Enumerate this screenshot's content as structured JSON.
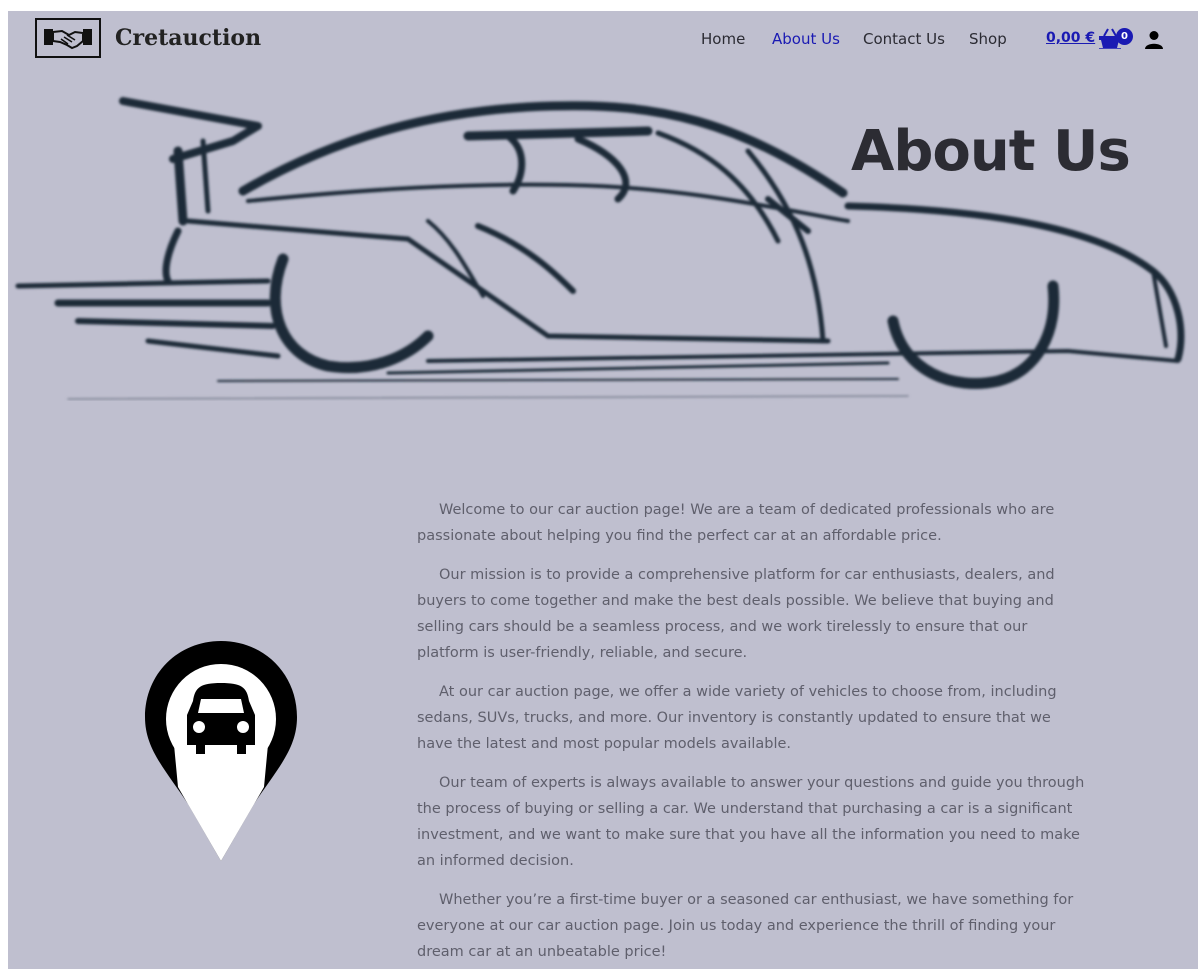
{
  "site": {
    "title": "Cretauction",
    "logo_icon": "handshake-icon"
  },
  "nav": {
    "items": [
      {
        "label": "Home",
        "active": false
      },
      {
        "label": "About Us",
        "active": true
      },
      {
        "label": "Contact Us",
        "active": false
      },
      {
        "label": "Shop",
        "active": false
      }
    ]
  },
  "cart": {
    "total": "0,00 €",
    "count": "0",
    "icon": "shopping-basket-icon"
  },
  "account": {
    "icon": "user-icon"
  },
  "hero": {
    "title": "About Us",
    "image": "sports-car-sketch"
  },
  "content": {
    "icon": "car-location-pin-icon",
    "paragraphs": [
      "Welcome to our car auction page! We are a team of dedicated professionals who are passionate about helping you find the perfect car at an affordable price.",
      "Our mission is to provide a comprehensive platform for car enthusiasts, dealers, and buyers to come together and make the best deals possible. We believe that buying and selling cars should be a seamless process, and we work tirelessly to ensure that our platform is user-friendly, reliable, and secure.",
      "At our car auction page, we offer a wide variety of vehicles to choose from, including sedans, SUVs, trucks, and more. Our inventory is constantly updated to ensure that we have the latest and most popular models available.",
      "Our team of experts is always available to answer your questions and guide you through the process of buying or selling a car. We understand that purchasing a car is a significant investment, and we want to make sure that you have all the information you need to make an informed decision.",
      "Whether you’re a first-time buyer or a seasoned car enthusiast, we have something for everyone at our car auction page. Join us today and experience the thrill of finding your dream car at an unbeatable price!"
    ]
  },
  "colors": {
    "background": "#bfbfcf",
    "accent": "#1a1ab3",
    "text": "#5f5f6c",
    "heading": "#2c2c33",
    "sketch": "#1e2b38"
  }
}
